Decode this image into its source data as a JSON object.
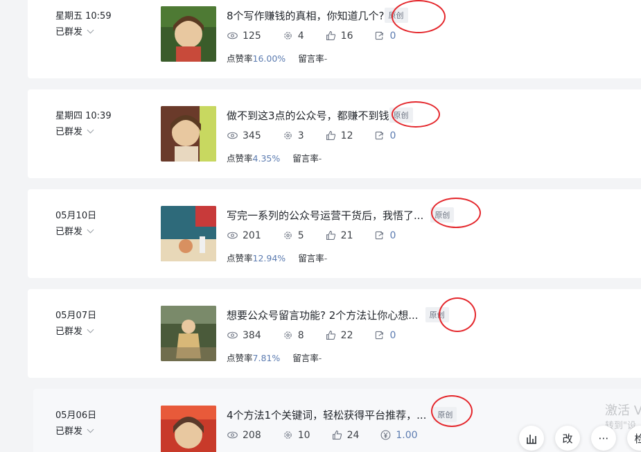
{
  "articles": [
    {
      "date": "星期五 10:59",
      "status": "已群发",
      "title": "8个写作赚钱的真相，你知道几个?",
      "tag": "原创",
      "reads": "125",
      "shares": "4",
      "likes": "16",
      "comments": "0",
      "like_rate_label": "点赞率",
      "like_rate": "16.00%",
      "comment_rate_label": "留言率",
      "comment_rate": "-",
      "thumb_colors": [
        "#3a5c2a",
        "#d8a870",
        "#5a3a22"
      ]
    },
    {
      "date": "星期四 10:39",
      "status": "已群发",
      "title": "做不到这3点的公众号，都赚不到钱",
      "tag": "原创",
      "reads": "345",
      "shares": "3",
      "likes": "12",
      "comments": "0",
      "like_rate_label": "点赞率",
      "like_rate": "4.35%",
      "comment_rate_label": "留言率",
      "comment_rate": "-",
      "thumb_colors": [
        "#6a3a2a",
        "#e0b48a",
        "#8a5a3a"
      ]
    },
    {
      "date": "05月10日",
      "status": "已群发",
      "title": "写完一系列的公众号运营干货后，我悟了...",
      "tag": "原创",
      "reads": "201",
      "shares": "5",
      "likes": "21",
      "comments": "0",
      "like_rate_label": "点赞率",
      "like_rate": "12.94%",
      "comment_rate_label": "留言率",
      "comment_rate": "-",
      "thumb_colors": [
        "#2e6a7a",
        "#c85a4a",
        "#e8d8b8"
      ]
    },
    {
      "date": "05月07日",
      "status": "已群发",
      "title": "想要公众号留言功能? 2个方法让你心想...",
      "tag": "原创",
      "reads": "384",
      "shares": "8",
      "likes": "22",
      "comments": "0",
      "like_rate_label": "点赞率",
      "like_rate": "7.81%",
      "comment_rate_label": "留言率",
      "comment_rate": "-",
      "thumb_colors": [
        "#4a5a3a",
        "#d8b878",
        "#8a7a5a"
      ]
    },
    {
      "date": "05月06日",
      "status": "已群发",
      "title": "4个方法1个关键词，轻松获得平台推荐，...",
      "tag": "原创",
      "reads": "208",
      "shares": "10",
      "likes": "24",
      "reward": "1.00",
      "thumb_colors": [
        "#c83a2a",
        "#e8c89a",
        "#5a3a2a"
      ]
    }
  ],
  "watermark": {
    "line1": "激活 V",
    "line2": "转到\"设"
  },
  "fabs": {
    "chart": "chart-icon",
    "edit": "改",
    "more": "⋯",
    "check": "检"
  },
  "colors": {
    "ring": "#e4262b",
    "rate_value": "#5b7bb0"
  }
}
